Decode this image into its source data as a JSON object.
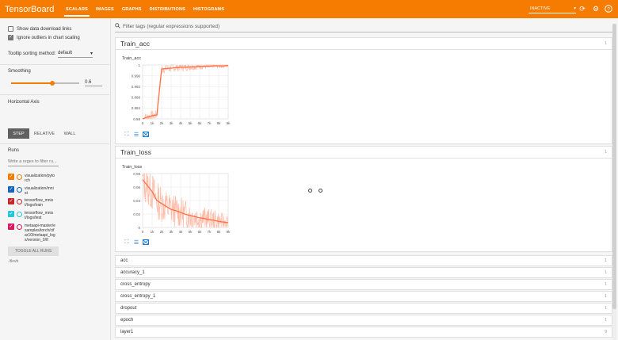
{
  "app": {
    "title": "TensorBoard"
  },
  "nav": {
    "tabs": [
      {
        "label": "SCALARS",
        "active": true
      },
      {
        "label": "IMAGES",
        "active": false
      },
      {
        "label": "GRAPHS",
        "active": false
      },
      {
        "label": "DISTRIBUTIONS",
        "active": false
      },
      {
        "label": "HISTOGRAMS",
        "active": false
      }
    ],
    "status": "INACTIVE",
    "icons": [
      "refresh-icon",
      "settings-icon",
      "help-icon"
    ]
  },
  "sidebar": {
    "show_download_links": {
      "label": "Show data download links",
      "checked": false
    },
    "ignore_outliers": {
      "label": "Ignore outliers in chart scaling",
      "checked": true
    },
    "sorting": {
      "label": "Tooltip sorting method:",
      "value": "default"
    },
    "smoothing": {
      "label": "Smoothing",
      "value": "0.6",
      "level": 0.6
    },
    "horizontal_axis": {
      "label": "Horizontal Axis",
      "options": [
        "STEP",
        "RELATIVE",
        "WALL"
      ],
      "selected": "STEP"
    },
    "runs": {
      "label": "Runs",
      "filter_placeholder": "Write a regex to filter ru...",
      "items": [
        {
          "name": "visualization/pyto\nrch",
          "color": "#f57c00",
          "checked": true
        },
        {
          "name": "visualization/mni\nst",
          "color": "#1565c0",
          "checked": true
        },
        {
          "name": "tensorflow_mnis\nt/logs/train",
          "color": "#c62828",
          "checked": true
        },
        {
          "name": "tensorflow_mnis\nt/logs/test",
          "color": "#26c6da",
          "checked": true
        },
        {
          "name": "metaapi-master/e\nsamples/torch/cif\nar10/metaapi_log\ns/version_0/tf",
          "color": "#d81b60",
          "checked": true
        }
      ],
      "toggle_label": "TOGGLE ALL RUNS",
      "logdir": "./tlevb"
    }
  },
  "main": {
    "filter_placeholder": "Filter tags (regular expressions supported)",
    "cards": [
      {
        "title": "Train_acc",
        "count": "1",
        "chart_title": "Train_acc"
      },
      {
        "title": "Train_loss",
        "count": "1",
        "chart_title": "Train_loss"
      }
    ],
    "categories": [
      {
        "name": "acc",
        "count": "1"
      },
      {
        "name": "accuracy_1",
        "count": "1"
      },
      {
        "name": "cross_entropy",
        "count": "1"
      },
      {
        "name": "cross_entropy_1",
        "count": "1"
      },
      {
        "name": "dropout",
        "count": "1"
      },
      {
        "name": "epoch",
        "count": "1"
      },
      {
        "name": "layer1",
        "count": "9"
      }
    ]
  },
  "chart_data": [
    {
      "type": "line",
      "title": "Train_acc",
      "x": [
        0,
        500,
        1000,
        1500,
        2000,
        2500,
        3000,
        3500,
        4000,
        4500,
        5000,
        5500,
        6000,
        6500,
        7000,
        7500,
        8000,
        8500,
        9000
      ],
      "series": [
        {
          "values": [
            0.88,
            0.884,
            0.887,
            0.889,
            0.991,
            0.992,
            0.993,
            0.994,
            0.995,
            0.995,
            0.996,
            0.996,
            0.997,
            0.997,
            0.997,
            0.998,
            0.998,
            0.998,
            0.999
          ]
        }
      ],
      "x_ticks": [
        "0",
        "1k",
        "2k",
        "3k",
        "4k",
        "5k",
        "6k",
        "7k",
        "8k",
        "9k"
      ],
      "y_ticks": [
        "0.88",
        "0.884",
        "0.888",
        "0.992",
        "0.996",
        "1"
      ],
      "ylim": [
        0.88,
        1.0
      ],
      "grid": true,
      "color": "#ff7043"
    },
    {
      "type": "line",
      "title": "Train_loss",
      "x": [
        0,
        500,
        1000,
        1500,
        2000,
        2500,
        3000,
        3500,
        4000,
        4500,
        5000,
        5500,
        6000,
        6500,
        7000,
        7500,
        8000,
        8500,
        9000
      ],
      "series": [
        {
          "values": [
            0.08,
            0.07,
            0.06,
            0.045,
            0.04,
            0.035,
            0.03,
            0.028,
            0.025,
            0.022,
            0.02,
            0.018,
            0.016,
            0.015,
            0.013,
            0.012,
            0.01,
            0.009,
            0.008
          ]
        }
      ],
      "x_ticks": [
        "0",
        "1k",
        "2k",
        "3k",
        "4k",
        "5k",
        "6k",
        "7k",
        "8k",
        "9k"
      ],
      "y_ticks": [
        "0",
        "0.02",
        "0.04",
        "0.06",
        "0.08"
      ],
      "ylim": [
        0,
        0.09
      ],
      "grid": true,
      "color": "#ff7043"
    }
  ]
}
